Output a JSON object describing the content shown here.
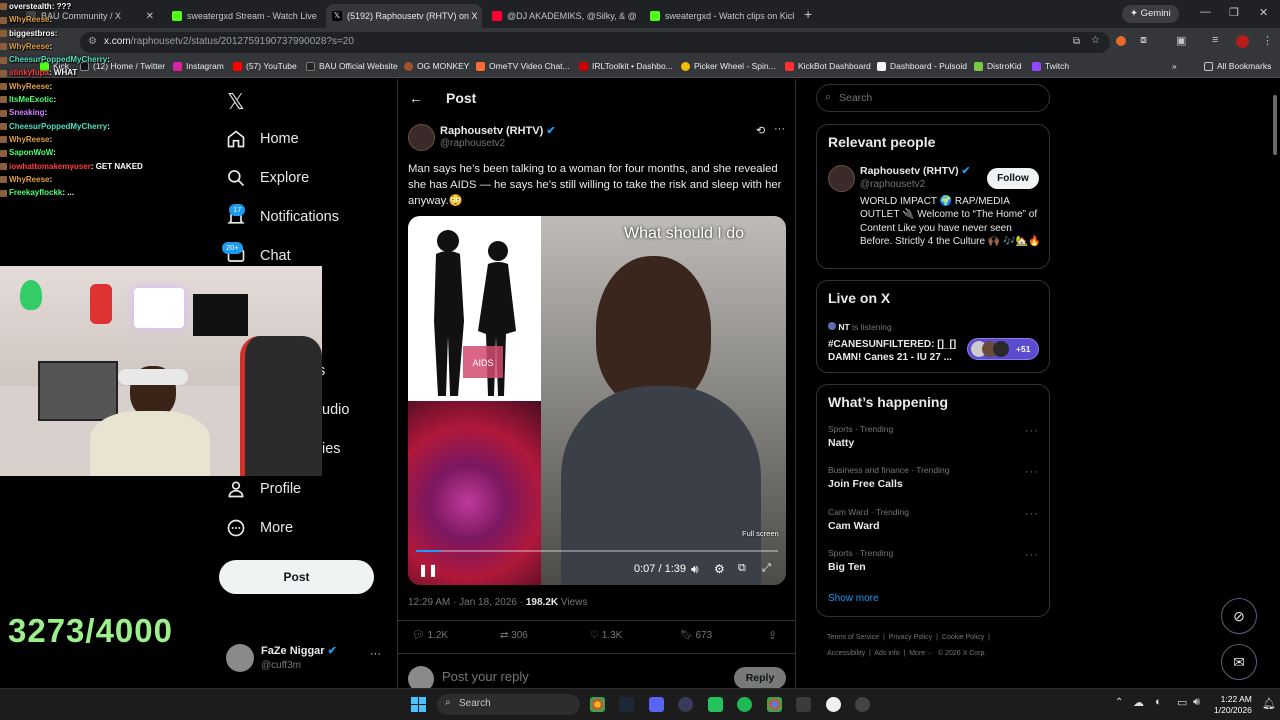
{
  "browser": {
    "tabs": [
      {
        "title": "BAU Community / X",
        "color": "#444"
      },
      {
        "title": "sweatergxd Stream - Watch Live",
        "color": "#53fc18"
      },
      {
        "title": "(5192) Raphousetv (RHTV) on X",
        "color": "#e7e9ea"
      },
      {
        "title": "@DJ AKADEMIKS, @Silky, & @",
        "color": "#ff0033"
      },
      {
        "title": "sweatergxd - Watch clips on Kick",
        "color": "#53fc18"
      }
    ],
    "gemini_label": "Gemini",
    "url_host": "x.com",
    "url_path": "/raphousetv2/status/2012759190737990028?s=20",
    "bookmarks": [
      {
        "label": "Kick",
        "color": "#53fc18"
      },
      {
        "label": "(12) Home / Twitter",
        "color": "#111"
      },
      {
        "label": "Instagram",
        "color": "#d6249f"
      },
      {
        "label": "(57) YouTube",
        "color": "#ff0000"
      },
      {
        "label": "BAU Official Website",
        "color": "#222"
      },
      {
        "label": "OG MONKEY",
        "color": "#a0522d"
      },
      {
        "label": "OmeTV Video Chat...",
        "color": "#ff6b35"
      },
      {
        "label": "IRLToolkit • Dashbo...",
        "color": "#cc0000"
      },
      {
        "label": "Picker Wheel - Spin...",
        "color": "#f0c000"
      },
      {
        "label": "KickBot Dashboard",
        "color": "#ff3030"
      },
      {
        "label": "Dashboard - Pulsoid",
        "color": "#f5f5f5"
      },
      {
        "label": "DistroKid",
        "color": "#7ac943"
      },
      {
        "label": "Twitch",
        "color": "#9146ff"
      }
    ],
    "all_bookmarks": "All Bookmarks"
  },
  "nav": {
    "home": "Home",
    "explore": "Explore",
    "notifications": "Notifications",
    "notif_badge": "17",
    "chat": "Chat",
    "chat_badge": "20+",
    "partial1": "s",
    "partial2": "udio",
    "partial3": "ies",
    "profile": "Profile",
    "more": "More",
    "post_button": "Post",
    "account_name": "FaZe Niggar",
    "account_handle": "@cuff3m"
  },
  "post": {
    "header": "Post",
    "author": "Raphousetv (RHTV)",
    "handle": "@raphousetv2",
    "text": "Man says he’s been talking to a woman for four months, and she revealed she has AIDS — he says he’s still willing to take the risk and sleep with her anyway.😳",
    "video_caption": "What should I do",
    "fullscreen_label": "Full screen",
    "time_current": "0:07",
    "time_total": "1:39",
    "progress": 0.07,
    "timestamp": "12:29 AM · Jan 18, 2026 · ",
    "views_count": "198.2K",
    "views_label": " Views",
    "replies": "1.2K",
    "reposts": "306",
    "likes": "1.3K",
    "bookmarks": "673",
    "reply_placeholder": "Post your reply",
    "reply_button": "Reply"
  },
  "sidebar": {
    "search_placeholder": "Search",
    "relevant_title": "Relevant people",
    "rp_name": "Raphousetv (RHTV)",
    "rp_handle": "@raphousetv2",
    "rp_follow": "Follow",
    "rp_bio": "WORLD IMPACT 🌍 RAP/MEDIA OUTLET 🔌 Welcome to “The Home” of Content Like you have never seen Before. Strictly 4 the Culture 🙌🏾 🎶🏡🔥",
    "live_title": "Live on X",
    "live_host": "NT",
    "live_status": " is listening",
    "live_text": "#CANESUNFILTERED: []_[] DAMN! Canes 21 - IU 27 ...",
    "live_count": "+51",
    "happening_title": "What’s happening",
    "trends": [
      {
        "meta": "Sports · Trending",
        "name": "Natty"
      },
      {
        "meta": "Business and finance · Trending",
        "name": "Join Free Calls"
      },
      {
        "meta": "Cam Ward · Trending",
        "name": "Cam Ward"
      },
      {
        "meta": "Sports · Trending",
        "name": "Big Ten"
      }
    ],
    "show_more": "Show more",
    "footer1": "Terms of Service  |  Privacy Policy  |  Cookie Policy  |",
    "footer2": "Accessibility  |  Ads info  |  More ···  © 2026 X Corp."
  },
  "overlay": {
    "chat": [
      {
        "user": "overstealth",
        "msg": "???",
        "color": "#ffffff"
      },
      {
        "user": "WhyReese",
        "msg": "",
        "color": "#e0a040"
      },
      {
        "user": "biggestbros",
        "msg": "",
        "color": "#ffffff"
      },
      {
        "user": "WhyReese",
        "msg": "",
        "color": "#e0a040"
      },
      {
        "user": "CheesurPoppedMyCherry",
        "msg": "",
        "color": "#4ce0c0"
      },
      {
        "user": "stinkyfupa",
        "msg": "WHAT",
        "color": "#ff3c3c"
      },
      {
        "user": "WhyReese",
        "msg": "",
        "color": "#e0a040"
      },
      {
        "user": "ItsMeExotic",
        "msg": "",
        "color": "#4cff70"
      },
      {
        "user": "Sneaking",
        "msg": "",
        "color": "#d080ff"
      },
      {
        "user": "CheesurPoppedMyCherry",
        "msg": "",
        "color": "#4ce0c0"
      },
      {
        "user": "WhyReese",
        "msg": "",
        "color": "#e0a040"
      },
      {
        "user": "SaponWoW",
        "msg": "",
        "color": "#4cff70"
      },
      {
        "user": "iowhattomakemyuser",
        "msg": "GET NAKED",
        "color": "#ff3c3c"
      },
      {
        "user": "WhyReese",
        "msg": "",
        "color": "#e0a040"
      },
      {
        "user": "Freekayflockk",
        "msg": "...",
        "color": "#4cff70"
      }
    ],
    "goal_counter": "3273/4000"
  },
  "taskbar": {
    "search": "Search",
    "time": "1:22 AM",
    "date": "1/20/2026"
  }
}
